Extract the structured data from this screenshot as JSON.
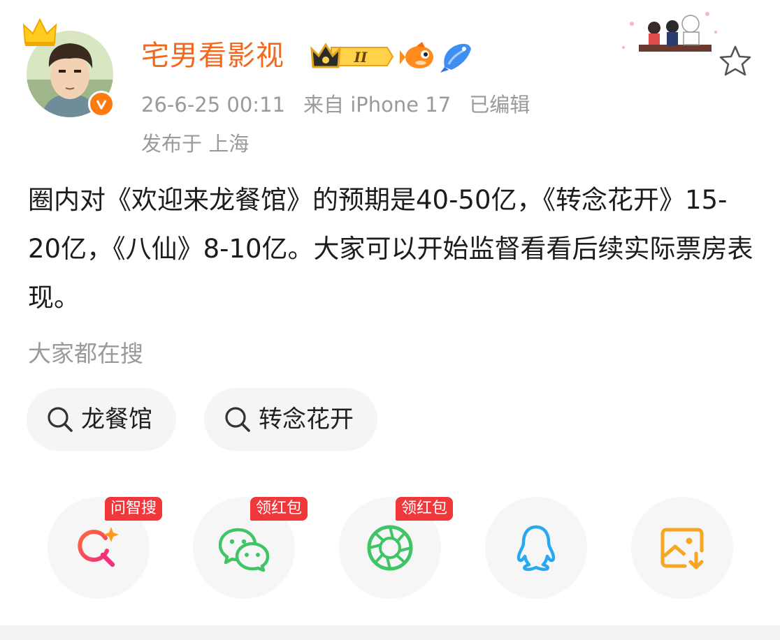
{
  "user": {
    "name": "宅男看影视",
    "medal_level": "II"
  },
  "meta": {
    "time": "26-6-25 00:11",
    "source": "来自 iPhone 17",
    "edited": "已编辑",
    "location": "发布于 上海"
  },
  "post": {
    "text": "圈内对《欢迎来龙餐馆》的预期是40-50亿，《转念花开》15-20亿，《八仙》8-10亿。大家可以开始监督看看后续实际票房表现。"
  },
  "hot_search": {
    "label": "大家都在搜",
    "items": [
      "龙餐馆",
      "转念花开"
    ]
  },
  "share": {
    "tags": [
      "问智搜",
      "领红包",
      "领红包"
    ],
    "icons": [
      "ai-search-icon",
      "wechat-icon",
      "moments-icon",
      "qq-icon",
      "save-image-icon"
    ]
  },
  "colors": {
    "username": "#f2681e",
    "meta_gray": "#9a9a9a",
    "tag_red": "#f0383b",
    "wechat_green": "#3fc565",
    "qq_blue": "#28a8f0",
    "save_orange": "#f5a623"
  }
}
